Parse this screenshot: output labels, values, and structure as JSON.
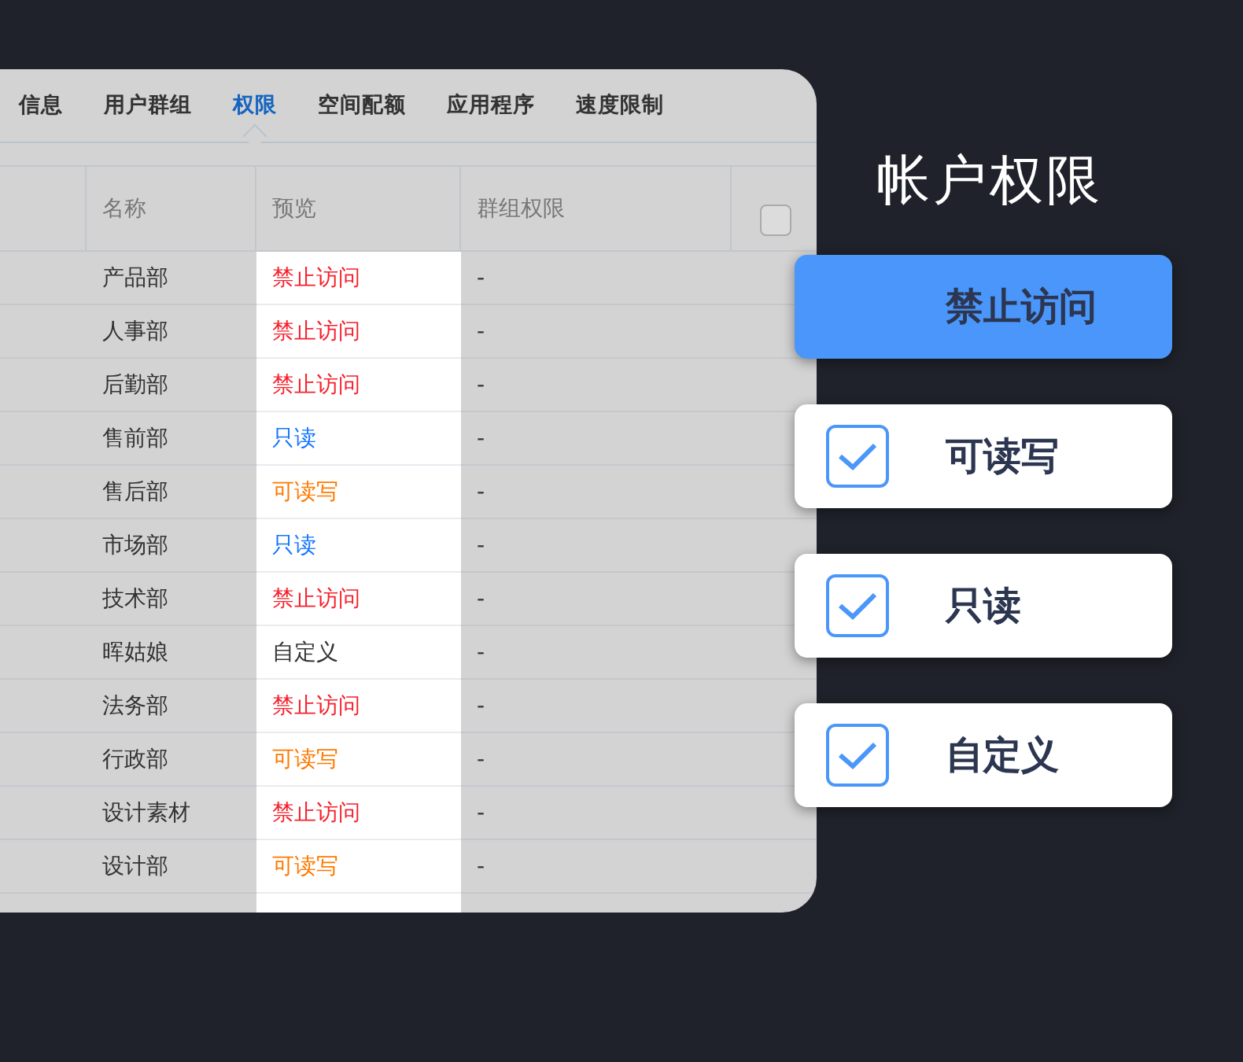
{
  "tabs": [
    {
      "label": "信息",
      "selected": false
    },
    {
      "label": "用户群组",
      "selected": false
    },
    {
      "label": "权限",
      "selected": true
    },
    {
      "label": "空间配额",
      "selected": false
    },
    {
      "label": "应用程序",
      "selected": false
    },
    {
      "label": "速度限制",
      "selected": false
    }
  ],
  "table": {
    "columns": [
      "名称",
      "预览",
      "群组权限"
    ],
    "select_all": {
      "checked": false
    },
    "rows": [
      {
        "name": "产品部",
        "preview": "禁止访问",
        "color": "#f5222d",
        "group": "-"
      },
      {
        "name": "人事部",
        "preview": "禁止访问",
        "color": "#f5222d",
        "group": "-"
      },
      {
        "name": "后勤部",
        "preview": "禁止访问",
        "color": "#f5222d",
        "group": "-"
      },
      {
        "name": "售前部",
        "preview": "只读",
        "color": "#1677ff",
        "group": "-"
      },
      {
        "name": "售后部",
        "preview": "可读写",
        "color": "#ff7a00",
        "group": "-"
      },
      {
        "name": "市场部",
        "preview": "只读",
        "color": "#1677ff",
        "group": "-"
      },
      {
        "name": "技术部",
        "preview": "禁止访问",
        "color": "#f5222d",
        "group": "-"
      },
      {
        "name": "晖姑娘",
        "preview": "自定义",
        "color": "#333333",
        "group": "-"
      },
      {
        "name": "法务部",
        "preview": "禁止访问",
        "color": "#f5222d",
        "group": "-"
      },
      {
        "name": "行政部",
        "preview": "可读写",
        "color": "#ff7a00",
        "group": "-"
      },
      {
        "name": "设计素材",
        "preview": "禁止访问",
        "color": "#f5222d",
        "group": "-"
      },
      {
        "name": "设计部",
        "preview": "可读写",
        "color": "#ff7a00",
        "group": "-"
      }
    ]
  },
  "legend": {
    "title": "帐户权限",
    "items": [
      {
        "kind": "button",
        "label": "禁止访问"
      },
      {
        "kind": "checkbox",
        "label": "可读写",
        "checked": true
      },
      {
        "kind": "checkbox",
        "label": "只读",
        "checked": true
      },
      {
        "kind": "checkbox",
        "label": "自定义",
        "checked": true
      }
    ]
  }
}
